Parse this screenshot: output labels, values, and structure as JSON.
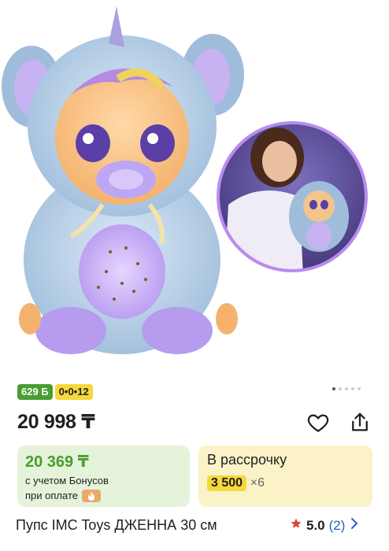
{
  "gallery": {
    "main_image": "doll-in-blue-unicorn-costume",
    "inset_image": "girl-holding-doll-photo",
    "pager_dots": 5,
    "active_dot": 0
  },
  "badges": {
    "bonus": "629 Б",
    "installment": "0•0•12"
  },
  "price": {
    "value": "20 998 ₸"
  },
  "actions": {
    "favorite_icon": "heart-icon",
    "share_icon": "share-icon"
  },
  "bonus_card": {
    "price": "20 369 ₸",
    "line1": "с учетом Бонусов",
    "line2": "при оплате",
    "pay_icon": "payment-service-icon"
  },
  "installment_card": {
    "title": "В рассрочку",
    "amount": "3 500",
    "multiplier": "×6"
  },
  "product": {
    "title": "Пупс IMC Toys ДЖЕННА 30 см",
    "rating": "5.0",
    "reviews": "(2)",
    "star_icon": "star-icon",
    "chevron_icon": "chevron-right-icon"
  },
  "colors": {
    "green": "#4a9d2f",
    "yellow": "#f6d83a",
    "link": "#2a61c9",
    "star": "#e0463c"
  }
}
